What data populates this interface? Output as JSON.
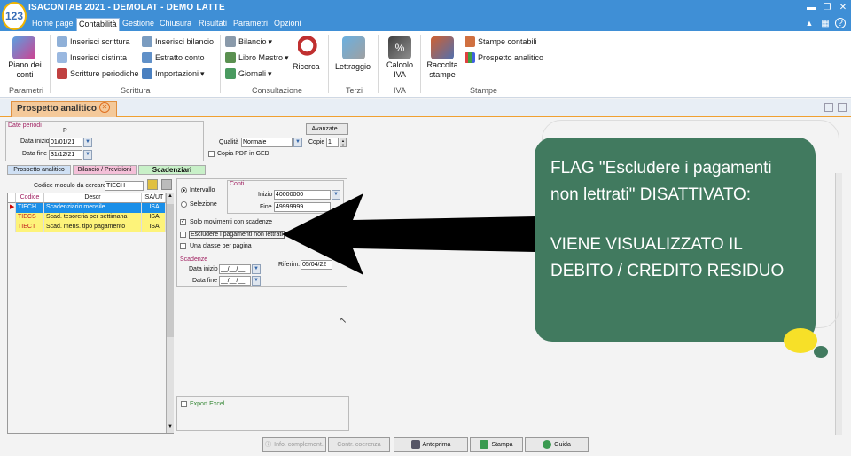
{
  "app": {
    "title": "ISACONTAB 2021 - DEMOLAT - DEMO LATTE",
    "logo": "123"
  },
  "menu": [
    "Home page",
    "Contabilità",
    "Gestione",
    "Chiusura",
    "Risultati",
    "Parametri",
    "Opzioni"
  ],
  "window_buttons": {
    "minimize": "▬",
    "restore": "❐",
    "close": "✕"
  },
  "ribbon": {
    "piano": "Piano dei conti",
    "inserisci_scrittura": "Inserisci scrittura",
    "inserisci_distinta": "Inserisci distinta",
    "scritture_periodiche": "Scritture periodiche",
    "inserisci_bilancio": "Inserisci bilancio",
    "estratto_conto": "Estratto conto",
    "importazioni": "Importazioni",
    "bilancio": "Bilancio",
    "libro_mastro": "Libro Mastro",
    "giornali": "Giornali",
    "ricerca": "Ricerca",
    "lettraggio": "Lettraggio",
    "calcolo_iva": "Calcolo IVA",
    "raccolta_stampe": "Raccolta stampe",
    "stampe_contabili": "Stampe contabili",
    "prospetto_analitico": "Prospetto analitico",
    "groups": {
      "parametri": "Parametri",
      "scrittura": "Scrittura",
      "consultazione": "Consultazione",
      "terzi": "Terzi",
      "iva": "IVA",
      "stampe": "Stampe"
    }
  },
  "tab": {
    "label": "Prospetto analitico",
    "close": "✕"
  },
  "dates": {
    "legend": "Date periodi",
    "p": "P",
    "inizio_label": "Data inizio",
    "inizio": "01/01/21",
    "fine_label": "Data fine",
    "fine": "31/12/21"
  },
  "avanzate": "Avanzate...",
  "qualita": {
    "label": "Qualità",
    "value": "Normale"
  },
  "copie": {
    "label": "Copie",
    "value": "1"
  },
  "copia_pdf": "Copia PDF in GED",
  "subtabs": [
    "Prospetto analitico",
    "Bilancio / Previsioni",
    "Scadenziari"
  ],
  "codice_search": {
    "label": "Codice modulo da cercare",
    "value": "TIECH"
  },
  "grid": {
    "headers": [
      "Codice",
      "Descr",
      "ISA/UT"
    ],
    "rows": [
      [
        "TIECH",
        "Scadenziario mensile",
        "ISA"
      ],
      [
        "TIECS",
        "Scad. tesoreria per settimana",
        "ISA"
      ],
      [
        "TIECT",
        "Scad. mens. tipo pagamento",
        "ISA"
      ]
    ]
  },
  "scope": {
    "intervallo": "Intervallo",
    "selezione": "Selezione"
  },
  "conti": {
    "legend": "Conti",
    "inizio_label": "Inizio",
    "inizio": "40000000",
    "fine_label": "Fine",
    "fine": "49999999"
  },
  "options": {
    "solo": "Solo movimenti con scadenze",
    "escludere": "Escludere i pagamenti non lettrati",
    "una_classe": "Una classe per pagina"
  },
  "scadenze": {
    "legend": "Scadenze",
    "inizio_label": "Data inizio",
    "inizio": "__/__/__",
    "fine_label": "Data fine",
    "fine": "__/__/__",
    "riferim_label": "Riferim.",
    "riferim": "05/04/22"
  },
  "export": "Export Excel",
  "buttons": {
    "info": "Info. complement.",
    "coerenza": "Contr. coerenza",
    "anteprima": "Anteprima",
    "stampa": "Stampa",
    "guida": "Guida"
  },
  "callout": {
    "line1": "FLAG \"Escludere i pagamenti non lettrati\" DISATTIVATO:",
    "line2": "VIENE VISUALIZZATO IL DEBITO / CREDITO RESIDUO"
  }
}
